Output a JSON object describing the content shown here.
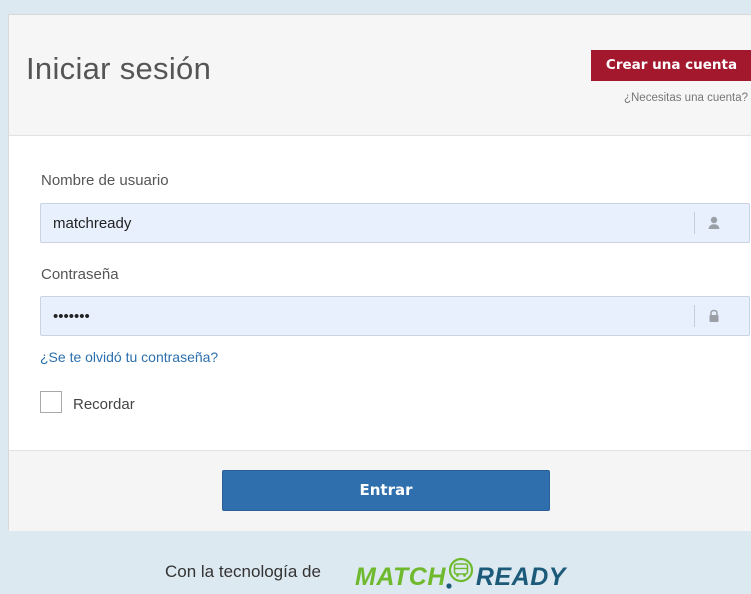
{
  "header": {
    "title": "Iniciar sesión",
    "create_account_label": "Crear una cuenta",
    "need_account_text": "¿Necesitas una cuenta?"
  },
  "form": {
    "username": {
      "label": "Nombre de usuario",
      "value": "matchready",
      "icon": "user-icon"
    },
    "password": {
      "label": "Contraseña",
      "value": "matchre",
      "icon": "lock-icon"
    },
    "forgot_link": "¿Se te olvidó tu contraseña?",
    "remember": {
      "label": "Recordar",
      "checked": false
    }
  },
  "footer": {
    "submit_label": "Entrar"
  },
  "branding": {
    "powered_by": "Con la tecnología de",
    "logo_part1": "MATCH",
    "logo_part2": "READY"
  },
  "colors": {
    "create_button": "#a3182d",
    "submit_button": "#2f6fad",
    "link": "#2b6fae",
    "logo_green": "#6fb92f",
    "logo_blue": "#1c5a7a"
  }
}
